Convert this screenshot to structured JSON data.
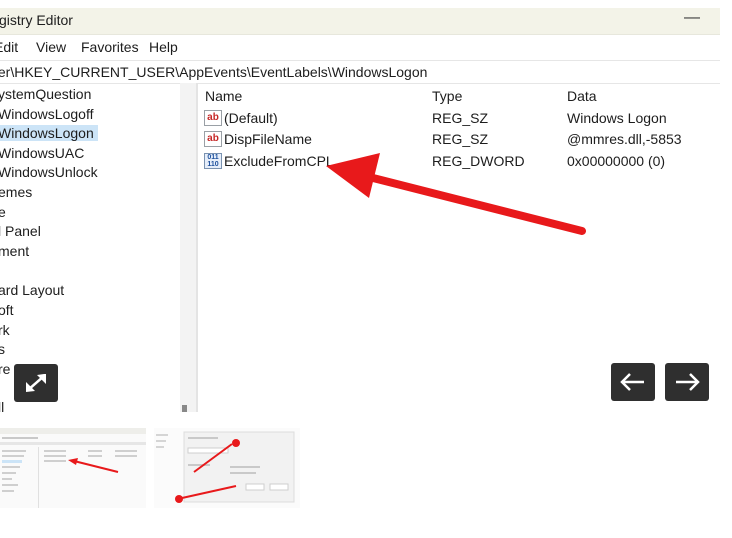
{
  "window": {
    "title": "gistry Editor",
    "minimize_glyph": "—"
  },
  "menu": [
    "Edit",
    "View",
    "Favorites",
    "Help"
  ],
  "address": "ter\\HKEY_CURRENT_USER\\AppEvents\\EventLabels\\WindowsLogon",
  "tree": [
    {
      "label": "ystemQuestion",
      "selected": false
    },
    {
      "label": "WindowsLogoff",
      "selected": false
    },
    {
      "label": "WindowsLogon",
      "selected": true
    },
    {
      "label": "WindowsUAC",
      "selected": false
    },
    {
      "label": "WindowsUnlock",
      "selected": false
    },
    {
      "label": "emes",
      "selected": false
    },
    {
      "label": "e",
      "selected": false
    },
    {
      "label": "l Panel",
      "selected": false
    },
    {
      "label": "ment",
      "selected": false
    },
    {
      "label": "",
      "selected": false
    },
    {
      "label": "ard Layout",
      "selected": false
    },
    {
      "label": "oft",
      "selected": false
    },
    {
      "label": "rk",
      "selected": false
    },
    {
      "label": "s",
      "selected": false
    },
    {
      "label": "re",
      "selected": false
    },
    {
      "label": "",
      "selected": false
    },
    {
      "label": "ll",
      "selected": false
    }
  ],
  "columns": {
    "name": "Name",
    "type": "Type",
    "data": "Data"
  },
  "values": [
    {
      "icon": "string-value-icon",
      "name": "(Default)",
      "type": "REG_SZ",
      "data": "Windows Logon"
    },
    {
      "icon": "string-value-icon",
      "name": "DispFileName",
      "type": "REG_SZ",
      "data": "@mmres.dll,-5853"
    },
    {
      "icon": "binary-value-icon",
      "name": "ExcludeFromCPL",
      "type": "REG_DWORD",
      "data": "0x00000000 (0)"
    }
  ],
  "icons": {
    "string_glyph": "ab",
    "binary_glyph": "011\n110",
    "expand": "expand-icon",
    "prev": "arrow-left-icon",
    "next": "arrow-right-icon"
  },
  "colors": {
    "arrow": "#e8191b",
    "selection": "#cce4f7",
    "control_bg": "#2f2f2f"
  }
}
